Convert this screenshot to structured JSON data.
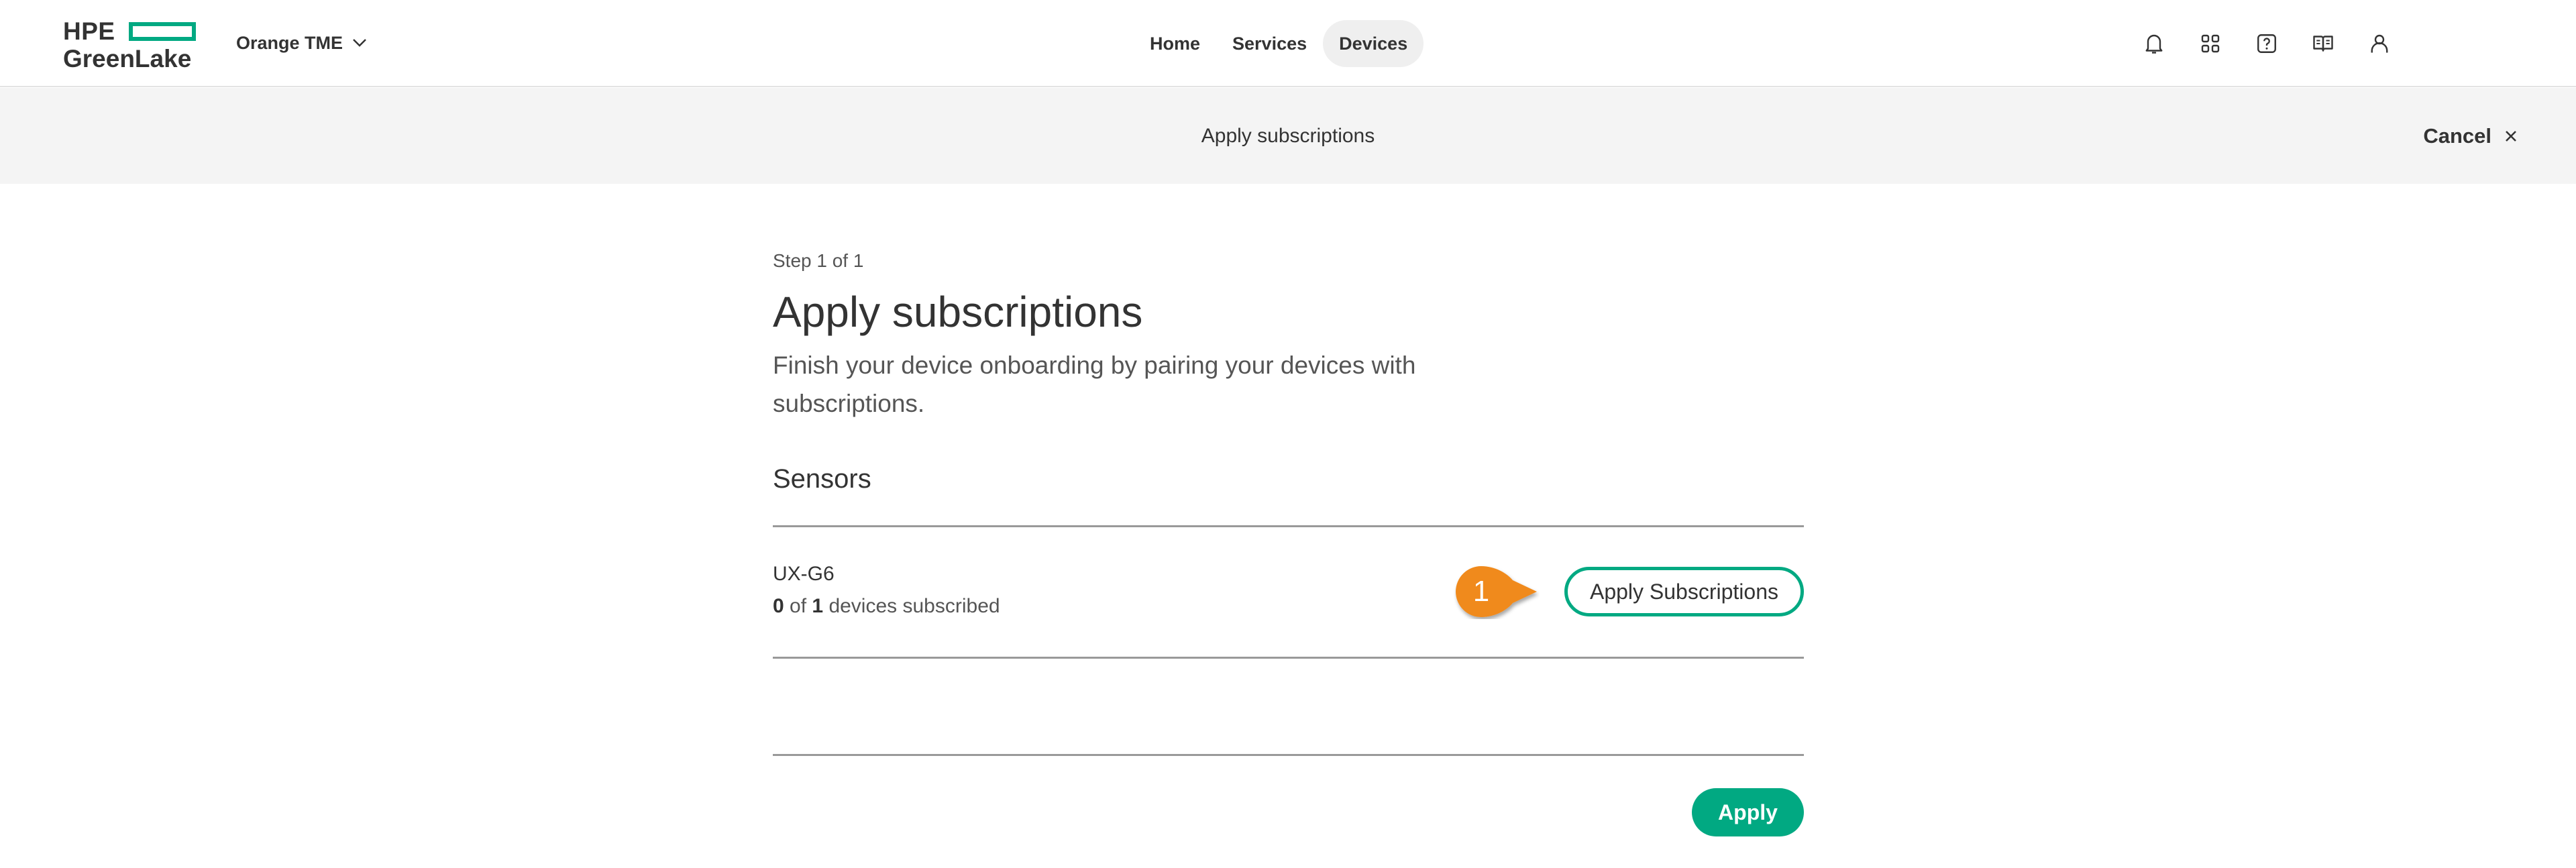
{
  "header": {
    "logo_top": "HPE",
    "logo_bottom": "GreenLake",
    "workspace": "Orange TME",
    "nav": [
      {
        "label": "Home"
      },
      {
        "label": "Services"
      },
      {
        "label": "Devices"
      }
    ],
    "active_nav": "Devices",
    "icons": [
      "bell-icon",
      "apps-grid-icon",
      "help-icon",
      "documentation-book-icon",
      "user-icon"
    ]
  },
  "wizard": {
    "title": "Apply subscriptions",
    "cancel_label": "Cancel"
  },
  "main": {
    "step": "Step 1 of 1",
    "title": "Apply subscriptions",
    "description": "Finish your device onboarding by pairing your devices with subscriptions.",
    "section_title": "Sensors",
    "device": {
      "name": "UX-G6",
      "subscribed_count": "0",
      "of_text": "of",
      "total_count": "1",
      "status_suffix": "devices subscribed",
      "action_label": "Apply Subscriptions"
    },
    "callout_number": "1",
    "apply_label": "Apply"
  },
  "colors": {
    "brand_green": "#01a982",
    "callout_orange": "#f08a1c",
    "bar_background": "#f4f4f4"
  }
}
